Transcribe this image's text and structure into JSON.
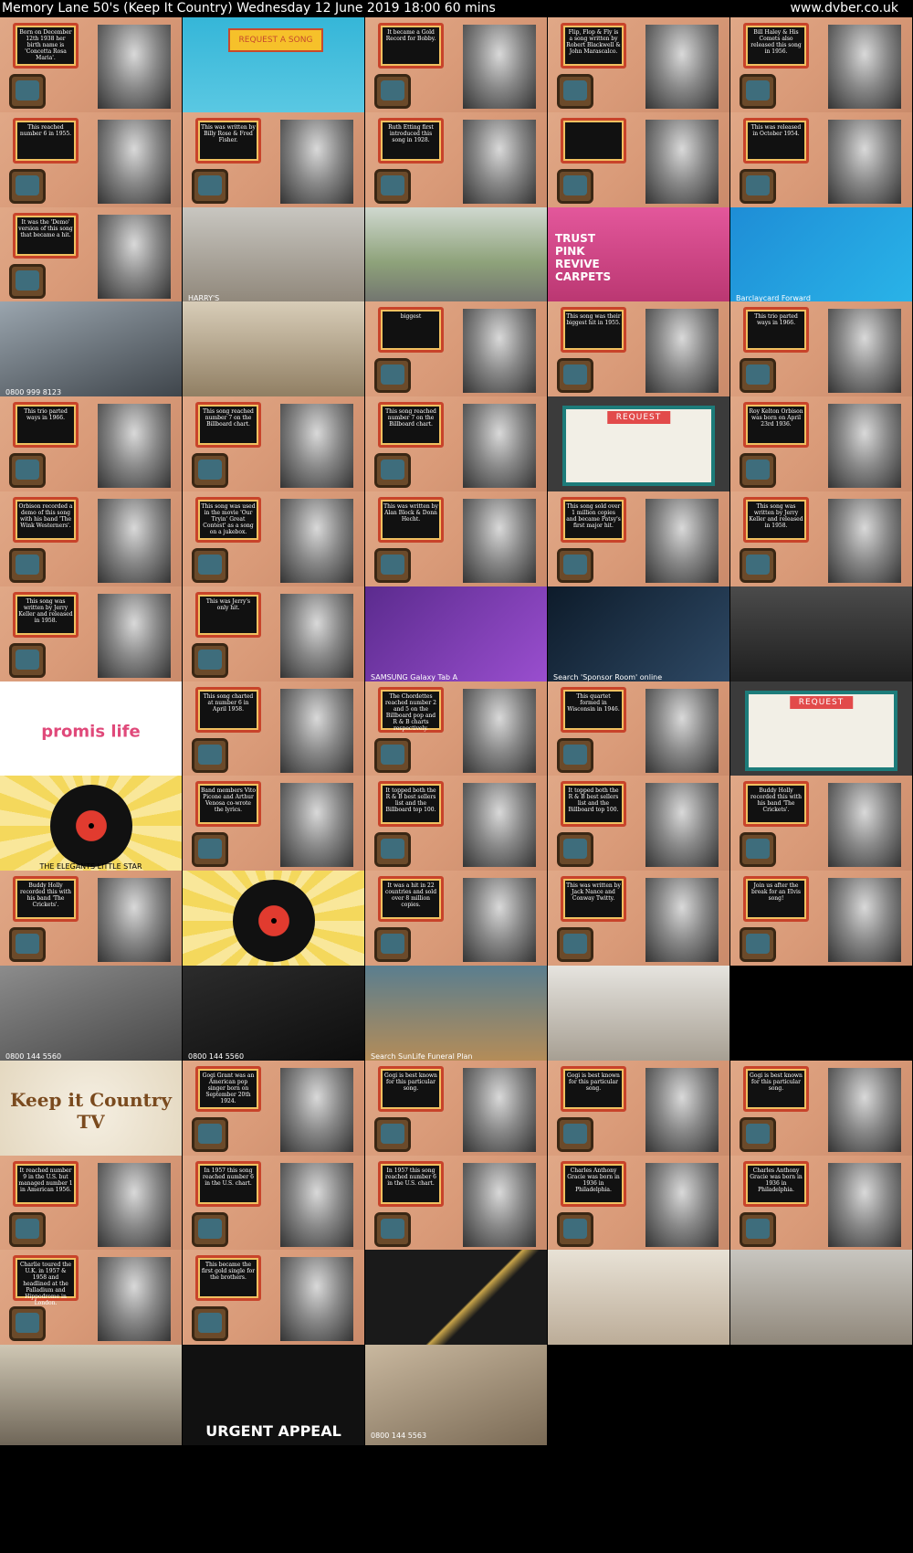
{
  "header": {
    "title": "Memory Lane 50's (Keep It Country)    Wednesday 12 June 2019  18:00  60 mins",
    "url": "www.dvber.co.uk"
  },
  "thumbnails": [
    {
      "kind": "show",
      "caption": "Born on December 12th 1938 her birth name is 'Concetta Rosa Maria'."
    },
    {
      "kind": "poster",
      "caption": "REQUEST A SONG"
    },
    {
      "kind": "show",
      "caption": "It became a Gold Record for Bobby."
    },
    {
      "kind": "show",
      "caption": "Flip, Flop & Fly is a song written by Robert Blackwell & John Marascalco."
    },
    {
      "kind": "show",
      "caption": "Bill Haley & His Comets also released this song in 1956."
    },
    {
      "kind": "show",
      "caption": "This reached number 6 in 1955."
    },
    {
      "kind": "show",
      "caption": "This was written by Billy Rose & Fred Fisher."
    },
    {
      "kind": "show",
      "caption": "Ruth Etting first introduced this song in 1928."
    },
    {
      "kind": "show",
      "caption": ""
    },
    {
      "kind": "show",
      "caption": "This was released in October 1954."
    },
    {
      "kind": "show",
      "caption": "It was the 'Demo' version of this song that became a hit."
    },
    {
      "kind": "ad-room",
      "caption": "HARRY'S"
    },
    {
      "kind": "ad-street",
      "caption": ""
    },
    {
      "kind": "ad-pink",
      "caption": "TRUST PINK REVIVE CARPETS"
    },
    {
      "kind": "ad-blue",
      "caption": "Barclaycard Forward"
    },
    {
      "kind": "ad-car",
      "caption": "0800 999 8123"
    },
    {
      "kind": "ad-kitchen",
      "caption": ""
    },
    {
      "kind": "show",
      "caption": "biggest"
    },
    {
      "kind": "show",
      "caption": "This song was their biggest hit in 1955."
    },
    {
      "kind": "show",
      "caption": "This trio parted ways in 1966."
    },
    {
      "kind": "show",
      "caption": "This trio parted ways in 1966."
    },
    {
      "kind": "show",
      "caption": "This song reached number 7 on the Billboard chart."
    },
    {
      "kind": "show",
      "caption": "This song reached number 7 on the Billboard chart."
    },
    {
      "kind": "letter",
      "caption": "REQUEST"
    },
    {
      "kind": "show",
      "caption": "Roy Kelton Orbison was born on April 23rd 1936."
    },
    {
      "kind": "show",
      "caption": "Orbison recorded a demo of this song with his band 'The Wink Westerners'."
    },
    {
      "kind": "show",
      "caption": "This song was used in the movie 'Our Tryin' Great Contest' as a song on a jukebox."
    },
    {
      "kind": "show",
      "caption": "This was written by Alan Block & Donn Hecht."
    },
    {
      "kind": "show",
      "caption": "This song sold over 1 million copies and became Patsy's first major hit."
    },
    {
      "kind": "show",
      "caption": "This song was written by Jerry Keller and released in 1958."
    },
    {
      "kind": "show",
      "caption": "This song was written by Jerry Keller and released in 1958."
    },
    {
      "kind": "show",
      "caption": "This was Jerry's only hit."
    },
    {
      "kind": "ad-purple",
      "caption": "SAMSUNG Galaxy Tab A"
    },
    {
      "kind": "ad-night",
      "caption": "Search 'Sponsor Room' online"
    },
    {
      "kind": "ad-tablet",
      "caption": ""
    },
    {
      "kind": "ad-white",
      "caption": "promis life"
    },
    {
      "kind": "show",
      "caption": "This song charted at number 6 in April 1958."
    },
    {
      "kind": "show",
      "caption": "The Chordettes reached number 2 and 5 on the Billboard pop and R & B charts respectively."
    },
    {
      "kind": "show",
      "caption": "This quartet formed in Wisconsin in 1946."
    },
    {
      "kind": "letter",
      "caption": "REQUEST"
    },
    {
      "kind": "record",
      "caption": "THE ELEGANTS LITTLE STAR"
    },
    {
      "kind": "show",
      "caption": "Band members Vito Picone and Arthur Venosa co-wrote the lyrics."
    },
    {
      "kind": "show",
      "caption": "It topped both the R & B best sellers list and the Billboard top 100."
    },
    {
      "kind": "show",
      "caption": "It topped both the R & B best sellers list and the Billboard top 100."
    },
    {
      "kind": "show",
      "caption": "Buddy Holly recorded this with his band 'The Crickets'."
    },
    {
      "kind": "show",
      "caption": "Buddy Holly recorded this with his band 'The Crickets'."
    },
    {
      "kind": "record",
      "caption": ""
    },
    {
      "kind": "show",
      "caption": "It was a hit in 22 countries and sold over 8 million copies."
    },
    {
      "kind": "show",
      "caption": "This was written by Jack Nance and Conway Twitty."
    },
    {
      "kind": "show",
      "caption": "Join us after the break for an Elvis song!"
    },
    {
      "kind": "ad-dog",
      "caption": "0800 144 5560"
    },
    {
      "kind": "ad-dog2",
      "caption": "0800 144 5560"
    },
    {
      "kind": "ad-shop",
      "caption": "Search SunLife Funeral Plan"
    },
    {
      "kind": "ad-hall",
      "caption": ""
    },
    {
      "kind": "blank",
      "caption": ""
    },
    {
      "kind": "country",
      "caption": "Keep it Country TV"
    },
    {
      "kind": "show",
      "caption": "Gogi Grant was an American pop singer born on September 20th 1924."
    },
    {
      "kind": "show",
      "caption": "Gogi is best known for this particular song."
    },
    {
      "kind": "show",
      "caption": "Gogi is best known for this particular song."
    },
    {
      "kind": "show",
      "caption": "Gogi is best known for this particular song."
    },
    {
      "kind": "show",
      "caption": "It reached number 9 in the U.S. but managed number 1 in American 1956."
    },
    {
      "kind": "show",
      "caption": "In 1957 this song reached number 6 in the U.S. chart."
    },
    {
      "kind": "show",
      "caption": "In 1957 this song reached number 6 in the U.S. chart."
    },
    {
      "kind": "show",
      "caption": "Charles Anthony Gracie was born in 1936 in Philadelphia."
    },
    {
      "kind": "show",
      "caption": "Charles Anthony Gracie was born in 1936 in Philadelphia."
    },
    {
      "kind": "show",
      "caption": "Charlie toured the U.K. in 1957 & 1958 and headlined at the Palladium and Hippodrome in London."
    },
    {
      "kind": "show",
      "caption": "This became the first gold single for the brothers."
    },
    {
      "kind": "gold",
      "caption": ""
    },
    {
      "kind": "ad-woman",
      "caption": ""
    },
    {
      "kind": "ad-room2",
      "caption": ""
    },
    {
      "kind": "ad-street2",
      "caption": ""
    },
    {
      "kind": "puppy",
      "caption": "URGENT APPEAL"
    },
    {
      "kind": "hamster",
      "caption": "0800 144 5563"
    },
    {
      "kind": "blank",
      "caption": ""
    },
    {
      "kind": "blank",
      "caption": ""
    }
  ]
}
